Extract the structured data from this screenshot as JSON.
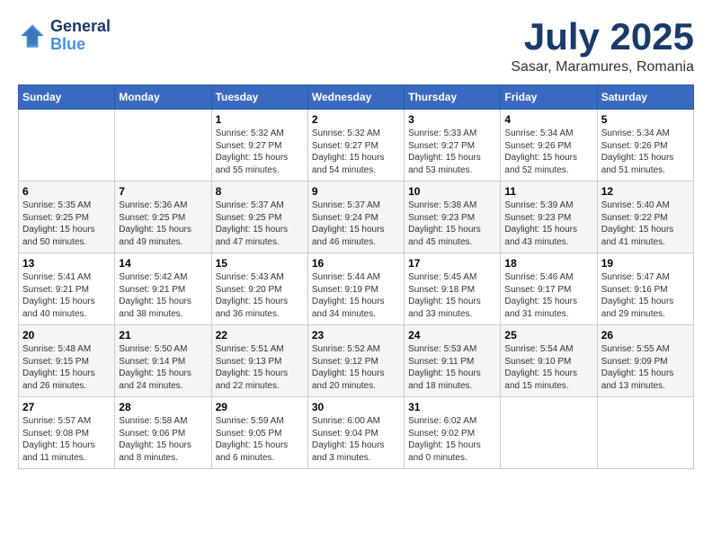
{
  "header": {
    "logo_line1": "General",
    "logo_line2": "Blue",
    "month_title": "July 2025",
    "subtitle": "Sasar, Maramures, Romania"
  },
  "weekdays": [
    "Sunday",
    "Monday",
    "Tuesday",
    "Wednesday",
    "Thursday",
    "Friday",
    "Saturday"
  ],
  "weeks": [
    [
      {
        "day": "",
        "sunrise": "",
        "sunset": "",
        "daylight": ""
      },
      {
        "day": "",
        "sunrise": "",
        "sunset": "",
        "daylight": ""
      },
      {
        "day": "1",
        "sunrise": "Sunrise: 5:32 AM",
        "sunset": "Sunset: 9:27 PM",
        "daylight": "Daylight: 15 hours and 55 minutes."
      },
      {
        "day": "2",
        "sunrise": "Sunrise: 5:32 AM",
        "sunset": "Sunset: 9:27 PM",
        "daylight": "Daylight: 15 hours and 54 minutes."
      },
      {
        "day": "3",
        "sunrise": "Sunrise: 5:33 AM",
        "sunset": "Sunset: 9:27 PM",
        "daylight": "Daylight: 15 hours and 53 minutes."
      },
      {
        "day": "4",
        "sunrise": "Sunrise: 5:34 AM",
        "sunset": "Sunset: 9:26 PM",
        "daylight": "Daylight: 15 hours and 52 minutes."
      },
      {
        "day": "5",
        "sunrise": "Sunrise: 5:34 AM",
        "sunset": "Sunset: 9:26 PM",
        "daylight": "Daylight: 15 hours and 51 minutes."
      }
    ],
    [
      {
        "day": "6",
        "sunrise": "Sunrise: 5:35 AM",
        "sunset": "Sunset: 9:25 PM",
        "daylight": "Daylight: 15 hours and 50 minutes."
      },
      {
        "day": "7",
        "sunrise": "Sunrise: 5:36 AM",
        "sunset": "Sunset: 9:25 PM",
        "daylight": "Daylight: 15 hours and 49 minutes."
      },
      {
        "day": "8",
        "sunrise": "Sunrise: 5:37 AM",
        "sunset": "Sunset: 9:25 PM",
        "daylight": "Daylight: 15 hours and 47 minutes."
      },
      {
        "day": "9",
        "sunrise": "Sunrise: 5:37 AM",
        "sunset": "Sunset: 9:24 PM",
        "daylight": "Daylight: 15 hours and 46 minutes."
      },
      {
        "day": "10",
        "sunrise": "Sunrise: 5:38 AM",
        "sunset": "Sunset: 9:23 PM",
        "daylight": "Daylight: 15 hours and 45 minutes."
      },
      {
        "day": "11",
        "sunrise": "Sunrise: 5:39 AM",
        "sunset": "Sunset: 9:23 PM",
        "daylight": "Daylight: 15 hours and 43 minutes."
      },
      {
        "day": "12",
        "sunrise": "Sunrise: 5:40 AM",
        "sunset": "Sunset: 9:22 PM",
        "daylight": "Daylight: 15 hours and 41 minutes."
      }
    ],
    [
      {
        "day": "13",
        "sunrise": "Sunrise: 5:41 AM",
        "sunset": "Sunset: 9:21 PM",
        "daylight": "Daylight: 15 hours and 40 minutes."
      },
      {
        "day": "14",
        "sunrise": "Sunrise: 5:42 AM",
        "sunset": "Sunset: 9:21 PM",
        "daylight": "Daylight: 15 hours and 38 minutes."
      },
      {
        "day": "15",
        "sunrise": "Sunrise: 5:43 AM",
        "sunset": "Sunset: 9:20 PM",
        "daylight": "Daylight: 15 hours and 36 minutes."
      },
      {
        "day": "16",
        "sunrise": "Sunrise: 5:44 AM",
        "sunset": "Sunset: 9:19 PM",
        "daylight": "Daylight: 15 hours and 34 minutes."
      },
      {
        "day": "17",
        "sunrise": "Sunrise: 5:45 AM",
        "sunset": "Sunset: 9:18 PM",
        "daylight": "Daylight: 15 hours and 33 minutes."
      },
      {
        "day": "18",
        "sunrise": "Sunrise: 5:46 AM",
        "sunset": "Sunset: 9:17 PM",
        "daylight": "Daylight: 15 hours and 31 minutes."
      },
      {
        "day": "19",
        "sunrise": "Sunrise: 5:47 AM",
        "sunset": "Sunset: 9:16 PM",
        "daylight": "Daylight: 15 hours and 29 minutes."
      }
    ],
    [
      {
        "day": "20",
        "sunrise": "Sunrise: 5:48 AM",
        "sunset": "Sunset: 9:15 PM",
        "daylight": "Daylight: 15 hours and 26 minutes."
      },
      {
        "day": "21",
        "sunrise": "Sunrise: 5:50 AM",
        "sunset": "Sunset: 9:14 PM",
        "daylight": "Daylight: 15 hours and 24 minutes."
      },
      {
        "day": "22",
        "sunrise": "Sunrise: 5:51 AM",
        "sunset": "Sunset: 9:13 PM",
        "daylight": "Daylight: 15 hours and 22 minutes."
      },
      {
        "day": "23",
        "sunrise": "Sunrise: 5:52 AM",
        "sunset": "Sunset: 9:12 PM",
        "daylight": "Daylight: 15 hours and 20 minutes."
      },
      {
        "day": "24",
        "sunrise": "Sunrise: 5:53 AM",
        "sunset": "Sunset: 9:11 PM",
        "daylight": "Daylight: 15 hours and 18 minutes."
      },
      {
        "day": "25",
        "sunrise": "Sunrise: 5:54 AM",
        "sunset": "Sunset: 9:10 PM",
        "daylight": "Daylight: 15 hours and 15 minutes."
      },
      {
        "day": "26",
        "sunrise": "Sunrise: 5:55 AM",
        "sunset": "Sunset: 9:09 PM",
        "daylight": "Daylight: 15 hours and 13 minutes."
      }
    ],
    [
      {
        "day": "27",
        "sunrise": "Sunrise: 5:57 AM",
        "sunset": "Sunset: 9:08 PM",
        "daylight": "Daylight: 15 hours and 11 minutes."
      },
      {
        "day": "28",
        "sunrise": "Sunrise: 5:58 AM",
        "sunset": "Sunset: 9:06 PM",
        "daylight": "Daylight: 15 hours and 8 minutes."
      },
      {
        "day": "29",
        "sunrise": "Sunrise: 5:59 AM",
        "sunset": "Sunset: 9:05 PM",
        "daylight": "Daylight: 15 hours and 6 minutes."
      },
      {
        "day": "30",
        "sunrise": "Sunrise: 6:00 AM",
        "sunset": "Sunset: 9:04 PM",
        "daylight": "Daylight: 15 hours and 3 minutes."
      },
      {
        "day": "31",
        "sunrise": "Sunrise: 6:02 AM",
        "sunset": "Sunset: 9:02 PM",
        "daylight": "Daylight: 15 hours and 0 minutes."
      },
      {
        "day": "",
        "sunrise": "",
        "sunset": "",
        "daylight": ""
      },
      {
        "day": "",
        "sunrise": "",
        "sunset": "",
        "daylight": ""
      }
    ]
  ]
}
